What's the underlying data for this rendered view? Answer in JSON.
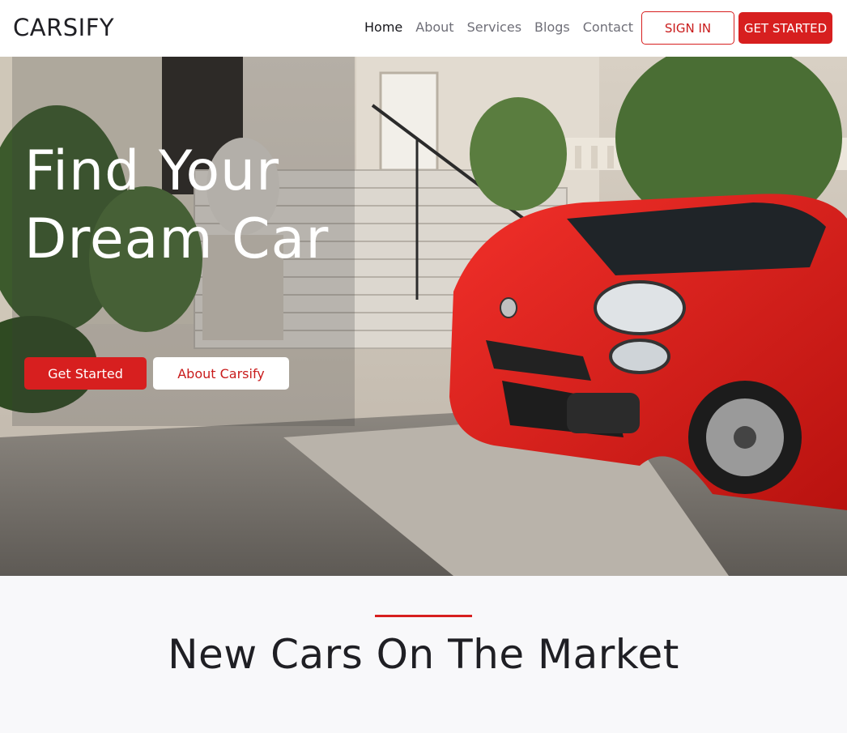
{
  "navbar": {
    "brand": "CARSIFY",
    "links": [
      {
        "label": "Home",
        "active": true
      },
      {
        "label": "About",
        "active": false
      },
      {
        "label": "Services",
        "active": false
      },
      {
        "label": "Blogs",
        "active": false
      },
      {
        "label": "Contact",
        "active": false
      }
    ],
    "signin_label": "SIGN IN",
    "get_started_label": "GET STARTED"
  },
  "hero": {
    "title_line1": "Find Your",
    "title_line2": "Dream Car",
    "primary_button": "Get Started",
    "secondary_button": "About Carsify",
    "image_subject": "red compact car parked in front of a villa staircase"
  },
  "section": {
    "title": "New Cars On The Market"
  },
  "colors": {
    "accent": "#d71f1f",
    "text_dark": "#1f1f24",
    "nav_muted": "#6f6f78",
    "section_bg": "#f8f8fa"
  }
}
